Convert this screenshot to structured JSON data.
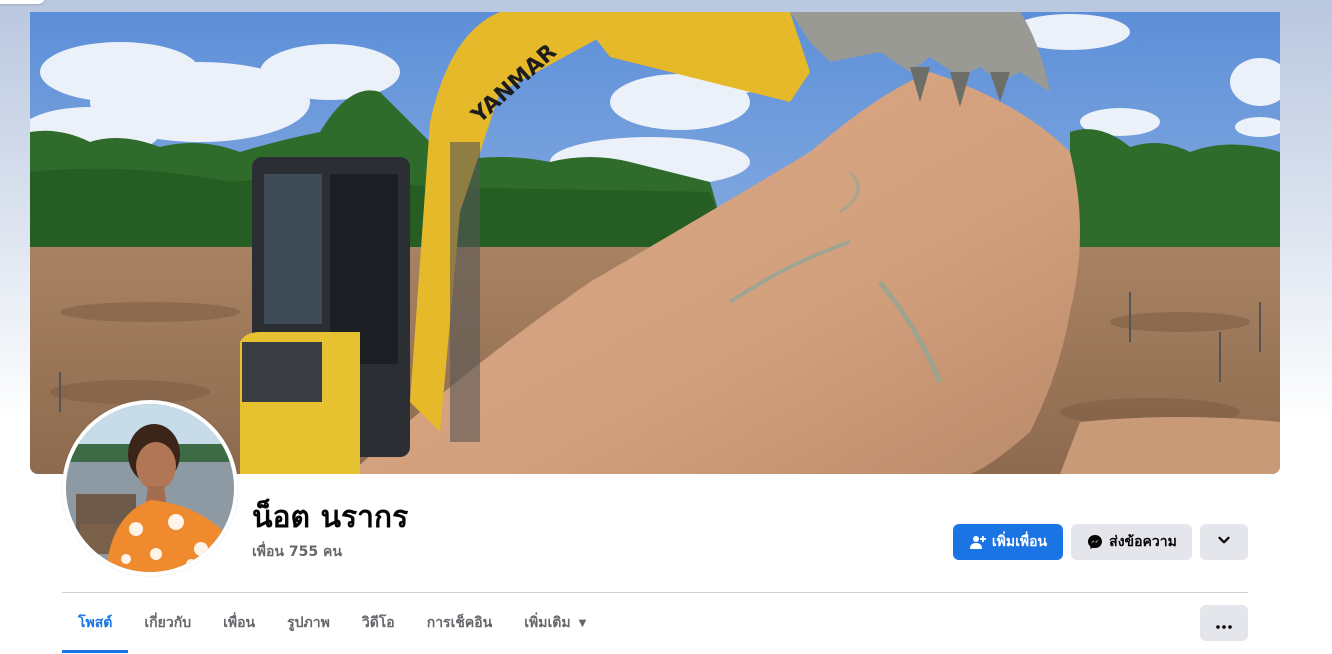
{
  "profile": {
    "name": "น็อต นรากร",
    "friends": "เพื่อน 755 คน"
  },
  "actions": {
    "add_friend": "เพิ่มเพื่อน",
    "message": "ส่งข้อความ"
  },
  "tabs": [
    {
      "label": "โพสต์",
      "active": true
    },
    {
      "label": "เกี่ยวกับ",
      "active": false
    },
    {
      "label": "เพื่อน",
      "active": false
    },
    {
      "label": "รูปภาพ",
      "active": false
    },
    {
      "label": "วิดีโอ",
      "active": false
    },
    {
      "label": "การเช็คอิน",
      "active": false
    },
    {
      "label": "เพิ่มเติม",
      "active": false
    }
  ],
  "cover": {
    "excavator_brand": "YANMAR"
  },
  "icons": {
    "add_friend": "person-plus-icon",
    "message": "messenger-icon",
    "dropdown": "chevron-down-icon",
    "tab_more_caret": "caret-down-icon",
    "tabs_menu": "ellipsis-icon"
  },
  "colors": {
    "primary": "#1b74e4",
    "secondary_button": "#e4e6eb",
    "muted_text": "#65676b",
    "text": "#050505"
  }
}
